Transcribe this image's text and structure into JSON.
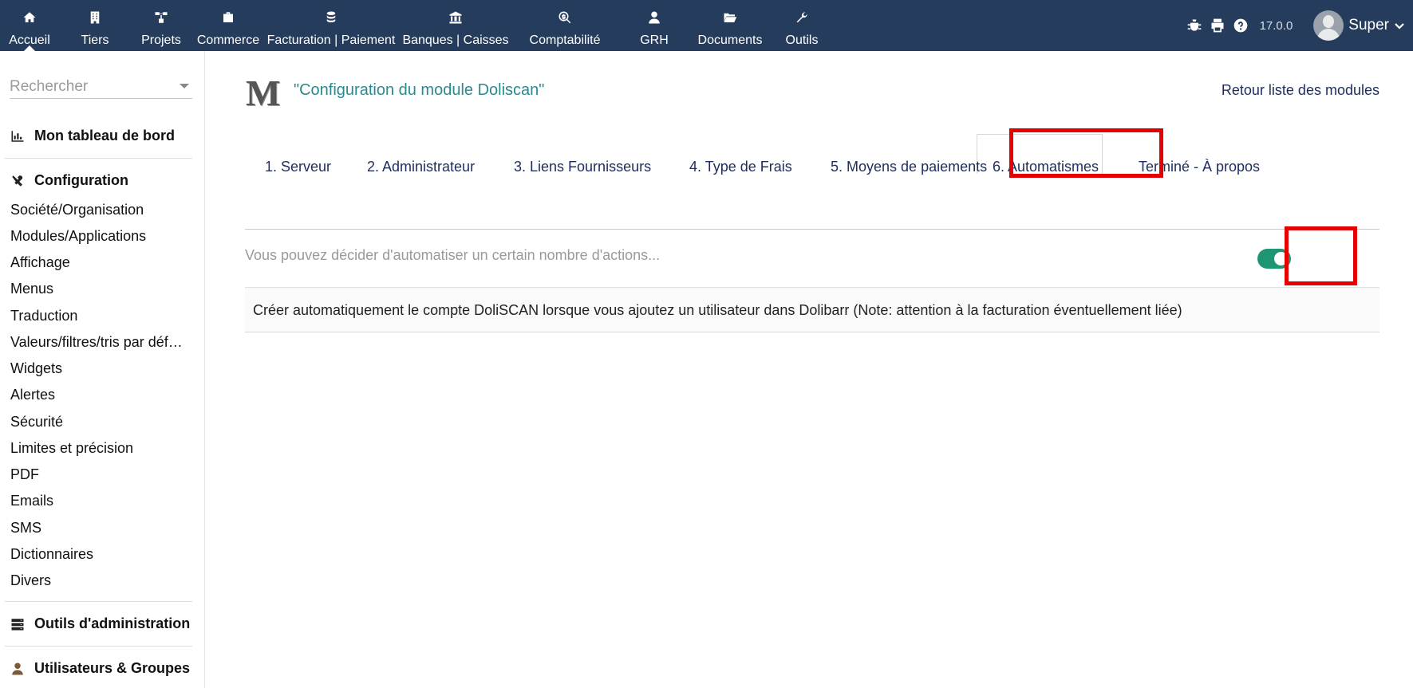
{
  "topbar": {
    "menu": [
      {
        "label": "Accueil",
        "icon": "home-icon",
        "active": true
      },
      {
        "label": "Tiers",
        "icon": "building-icon"
      },
      {
        "label": "Projets",
        "icon": "sitemap-icon"
      },
      {
        "label": "Commerce",
        "icon": "briefcase-icon"
      },
      {
        "label": "Facturation | Paiement",
        "icon": "coins-icon"
      },
      {
        "label": "Banques | Caisses",
        "icon": "bank-icon"
      },
      {
        "label": "Comptabilité",
        "icon": "magnify-dollar-icon"
      },
      {
        "label": "GRH",
        "icon": "user-tie-icon"
      },
      {
        "label": "Documents",
        "icon": "folder-open-icon"
      },
      {
        "label": "Outils",
        "icon": "wrench-icon"
      }
    ],
    "version": "17.0.0",
    "username": "Super",
    "right_icons": [
      "bug-icon",
      "printer-icon",
      "help-icon"
    ]
  },
  "sidebar": {
    "search_placeholder": "Rechercher",
    "dashboard": "Mon tableau de bord",
    "configuration": "Configuration",
    "config_items": [
      "Société/Organisation",
      "Modules/Applications",
      "Affichage",
      "Menus",
      "Traduction",
      "Valeurs/filtres/tris par défaut",
      "Widgets",
      "Alertes",
      "Sécurité",
      "Limites et précision",
      "PDF",
      "Emails",
      "SMS",
      "Dictionnaires",
      "Divers"
    ],
    "admin_tools": "Outils d'administration",
    "users_groups": "Utilisateurs & Groupes"
  },
  "main": {
    "module_logo": "M",
    "title": "\"Configuration du module Doliscan\"",
    "back_link": "Retour liste des modules",
    "tabs": [
      "1. Serveur",
      "2. Administrateur",
      "3. Liens Fournisseurs",
      "4. Type de Frais",
      "5. Moyens de paiements",
      "6. Automatismes",
      "Terminé - À propos"
    ],
    "active_tab": "6. Automatismes",
    "intro": "Vous pouvez décider d'automatiser un certain nombre d'actions...",
    "option": {
      "label": "Créer automatiquement le compte DoliSCAN lorsque vous ajoutez un utilisateur dans Dolibarr (Note: attention à la facturation éventuellement liée)",
      "enabled": true
    },
    "colors": {
      "topbar": "#263c5c",
      "link": "#1e2e60",
      "title": "#2a8a8f",
      "toggle_on": "#1e9673",
      "highlight": "#e40000"
    }
  }
}
